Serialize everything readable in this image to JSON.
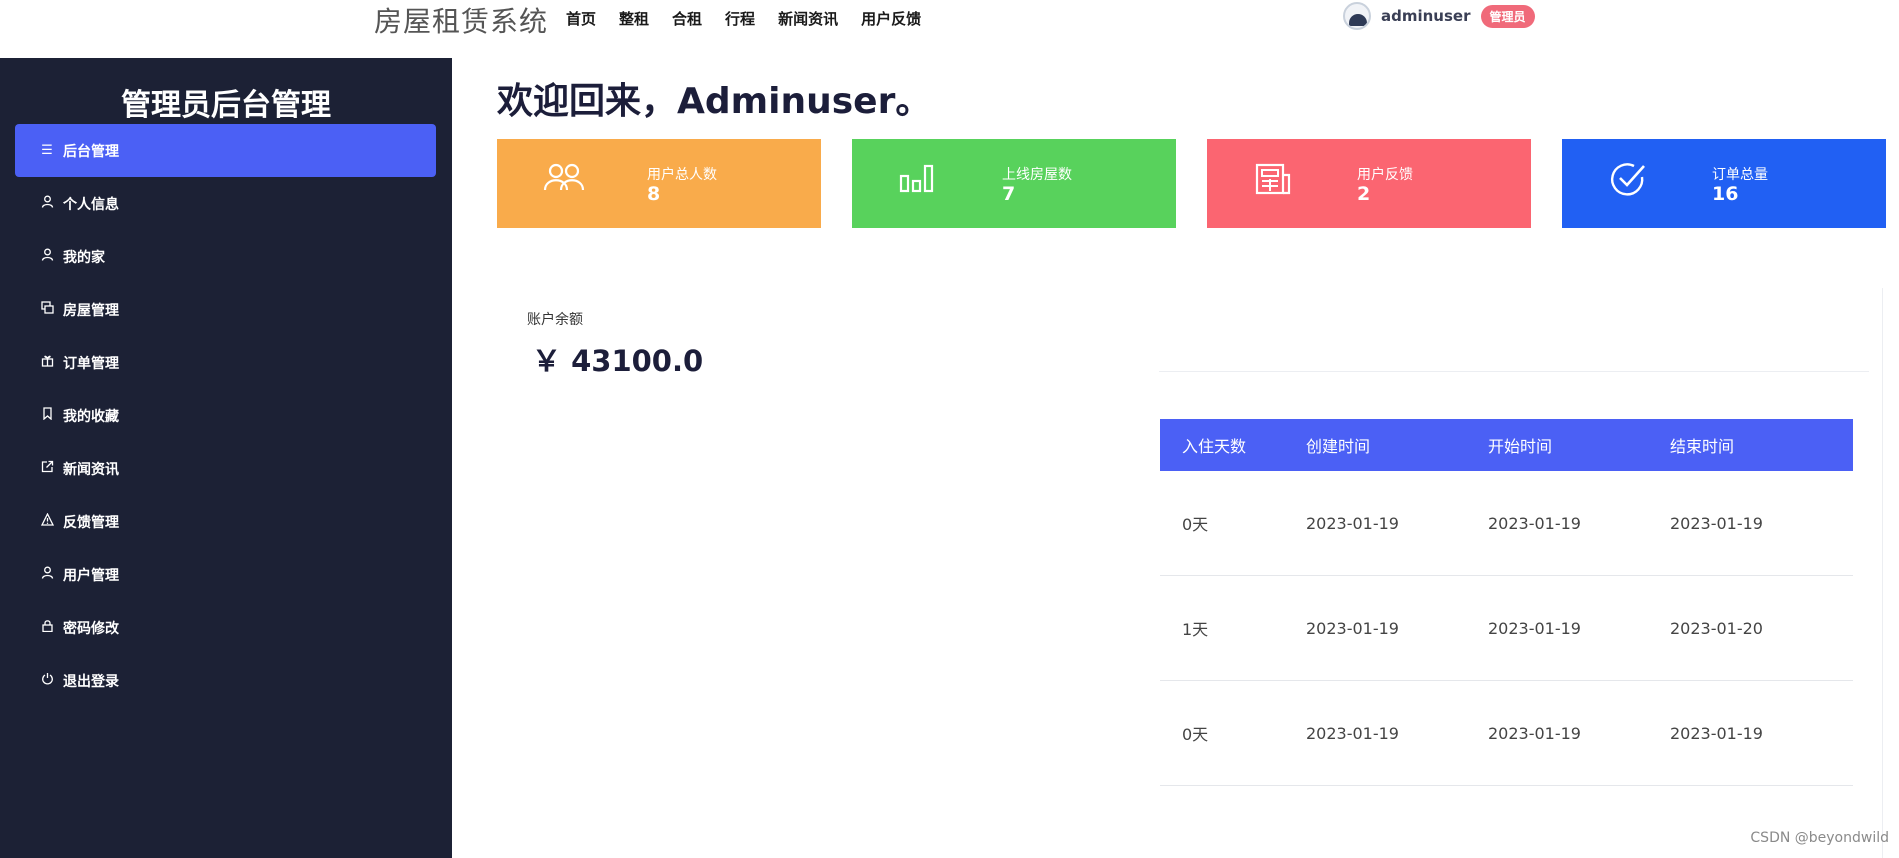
{
  "topbar": {
    "brand": "房屋租赁系统",
    "nav": [
      "首页",
      "整租",
      "合租",
      "行程",
      "新闻资讯",
      "用户反馈"
    ],
    "username": "adminuser",
    "role": "管理员"
  },
  "sidebar": {
    "title": "管理员后台管理",
    "items": [
      {
        "label": "后台管理",
        "icon": "menu-icon",
        "active": true
      },
      {
        "label": "个人信息",
        "icon": "user-icon"
      },
      {
        "label": "我的家",
        "icon": "user-icon"
      },
      {
        "label": "房屋管理",
        "icon": "copy-icon"
      },
      {
        "label": "订单管理",
        "icon": "gift-icon"
      },
      {
        "label": "我的收藏",
        "icon": "bookmark-icon"
      },
      {
        "label": "新闻资讯",
        "icon": "external-link-icon"
      },
      {
        "label": "反馈管理",
        "icon": "warning-icon"
      },
      {
        "label": "用户管理",
        "icon": "user-icon"
      },
      {
        "label": "密码修改",
        "icon": "lock-icon"
      },
      {
        "label": "退出登录",
        "icon": "power-icon"
      }
    ]
  },
  "main": {
    "welcome": "欢迎回来，Adminuser。",
    "cards": [
      {
        "label": "用户总人数",
        "value": "8",
        "color": "#f9ab4b",
        "icon": "users-icon"
      },
      {
        "label": "上线房屋数",
        "value": "7",
        "color": "#58d25c",
        "icon": "bar-chart-icon"
      },
      {
        "label": "用户反馈",
        "value": "2",
        "color": "#fb6571",
        "icon": "newspaper-icon"
      },
      {
        "label": "订单总量",
        "value": "16",
        "color": "#2160f3",
        "icon": "check-circle-icon"
      }
    ],
    "balance_label": "账户余额",
    "balance_value": "￥ 43100.0",
    "table": {
      "headers": [
        "入住天数",
        "创建时间",
        "开始时间",
        "结束时间"
      ],
      "rows": [
        [
          "0天",
          "2023-01-19",
          "2023-01-19",
          "2023-01-19"
        ],
        [
          "1天",
          "2023-01-19",
          "2023-01-19",
          "2023-01-20"
        ],
        [
          "0天",
          "2023-01-19",
          "2023-01-19",
          "2023-01-19"
        ]
      ]
    }
  },
  "watermark": "CSDN @beyondwild"
}
